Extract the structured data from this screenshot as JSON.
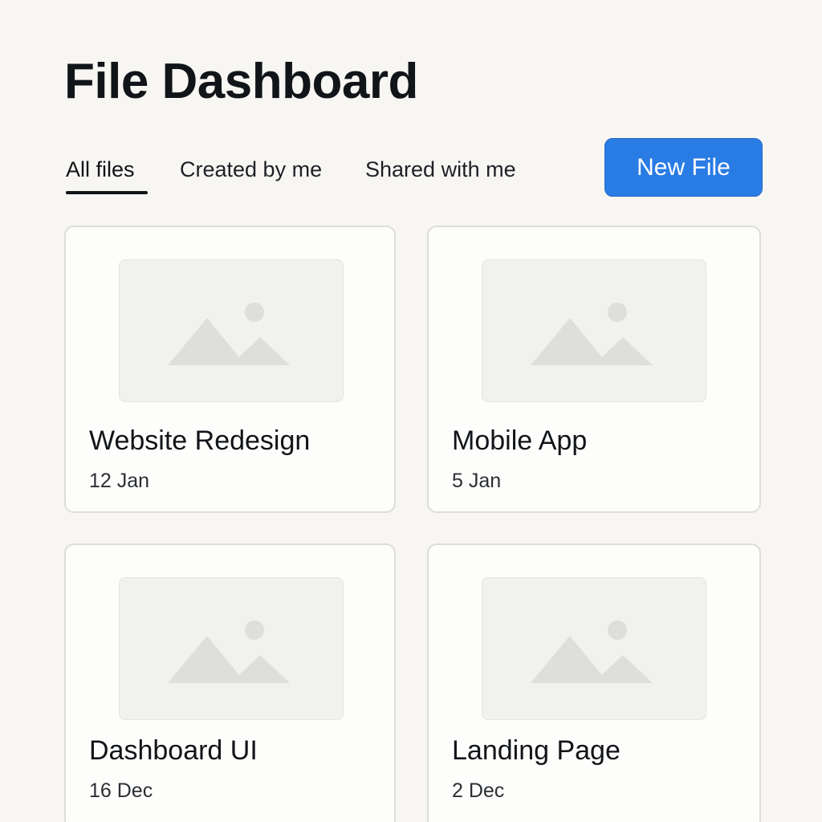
{
  "header": {
    "title": "File Dashboard"
  },
  "tabs": [
    {
      "label": "All files",
      "active": true
    },
    {
      "label": "Created by me",
      "active": false
    },
    {
      "label": "Shared with me",
      "active": false
    }
  ],
  "toolbar": {
    "new_file_label": "New File"
  },
  "files": [
    {
      "name": "Website Redesign",
      "date": "12 Jan",
      "thumbnail_icon": "image-placeholder-icon"
    },
    {
      "name": "Mobile App",
      "date": "5 Jan",
      "thumbnail_icon": "image-placeholder-icon"
    },
    {
      "name": "Dashboard UI",
      "date": "16 Dec",
      "thumbnail_icon": "image-placeholder-icon"
    },
    {
      "name": "Landing Page",
      "date": "2 Dec",
      "thumbnail_icon": "image-placeholder-icon"
    }
  ],
  "colors": {
    "background": "#f7f6f3",
    "accent": "#2a7ce5",
    "text": "#111418",
    "card_border": "#dedddb",
    "placeholder": "#dededc"
  }
}
